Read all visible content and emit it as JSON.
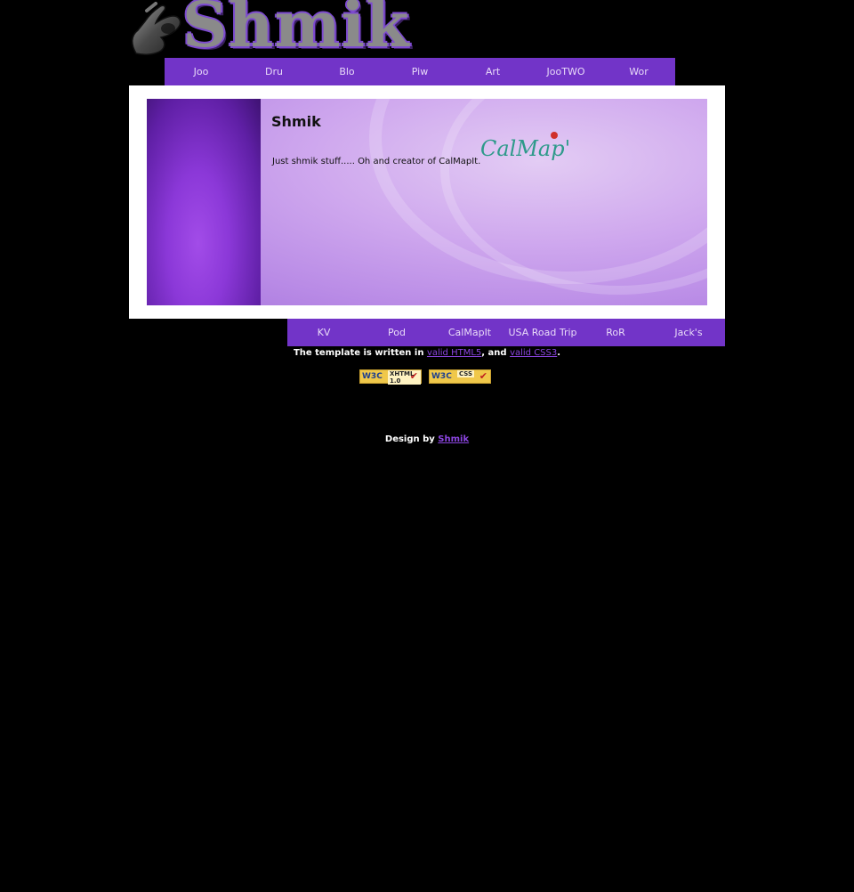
{
  "header": {
    "logo_text": "Shmik"
  },
  "top_nav": {
    "items": [
      "Joo",
      "Dru",
      "Blo",
      "Piw",
      "Art",
      "JooTWO",
      "Wor"
    ]
  },
  "content": {
    "title": "Shmik",
    "text": "Just shmik stuff..... Oh and creator of CalMapIt.",
    "calmapit_logo_text": "CalMap't"
  },
  "bottom_nav": {
    "items": [
      "KV",
      "Pod",
      "CalMapIt",
      "USA Road Trip",
      "RoR",
      "Jack's"
    ]
  },
  "footer": {
    "template_prefix": "The template is written in ",
    "html_link": "valid HTML5",
    "and_text": ", and ",
    "css_link": "valid CSS3",
    "period": ".",
    "badge_xhtml": {
      "w3c": "W3C",
      "label": "XHTML 1.0"
    },
    "badge_css": {
      "w3c": "W3C",
      "label": "CSS"
    },
    "design_prefix": "Design by ",
    "design_link": "Shmik"
  },
  "colors": {
    "background": "#000000",
    "nav_bg": "#7234c8",
    "link": "#8b45e0"
  }
}
